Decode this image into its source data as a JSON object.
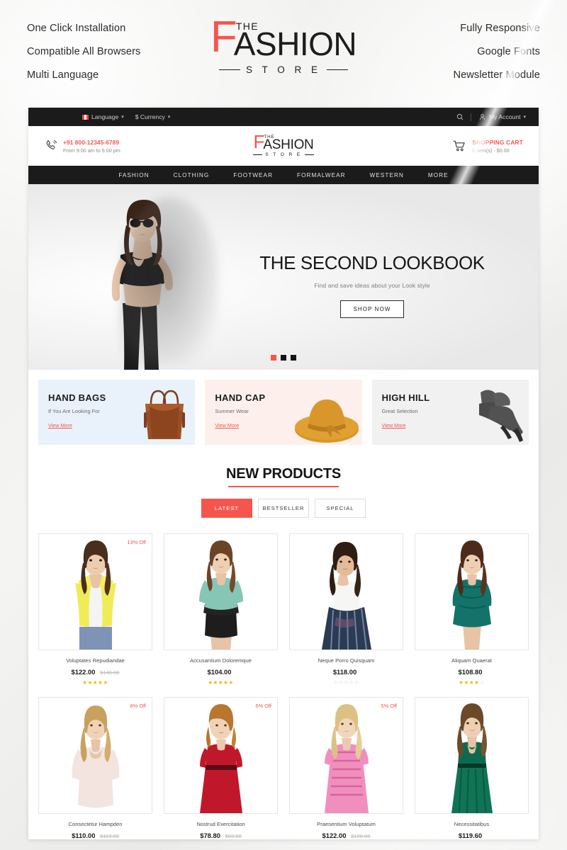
{
  "promo": {
    "left": [
      "One Click Installation",
      "Compatible All Browsers",
      "Multi Language"
    ],
    "right": [
      "Fully Responsive",
      "Google Fonts",
      "Newsletter Module"
    ]
  },
  "brand": {
    "f": "F",
    "the": "THE",
    "ashion": "ASHION",
    "store": "S T O R E"
  },
  "topbar": {
    "language": "Language",
    "currency": "$ Currency",
    "account": "My Account",
    "search_icon": "search-icon",
    "caret": "⌄"
  },
  "header": {
    "phone": "+91 800-12345-6789",
    "hours": "From 9:00 am to 5:00 pm",
    "cart_label": "SHOPPING CART",
    "cart_value": "0 item(s) - $0.00"
  },
  "nav": [
    "FASHION",
    "CLOTHING",
    "FOOTWEAR",
    "FORMALWEAR",
    "WESTERN",
    "MORE"
  ],
  "hero": {
    "title": "THE SECOND LOOKBOOK",
    "subtitle": "Find and save ideas about your Look style",
    "button": "SHOP NOW",
    "slides": 3,
    "active_slide": 1,
    "accent": "#f4564d"
  },
  "banners": [
    {
      "title": "HAND BAGS",
      "subtitle": "If You Are Looking For",
      "link": "View More",
      "bg": "#e9f2fa",
      "art": "handbag"
    },
    {
      "title": "HAND CAP",
      "subtitle": "Summer Wear",
      "link": "View More",
      "bg": "#fdf0ec",
      "art": "hat"
    },
    {
      "title": "HIGH HILL",
      "subtitle": "Great Selection",
      "link": "View More",
      "bg": "#f1f1f1",
      "art": "heels"
    }
  ],
  "new_products": {
    "title": "NEW PRODUCTS",
    "tabs": [
      {
        "label": "LATEST",
        "active": true
      },
      {
        "label": "BESTSELLER",
        "active": false
      },
      {
        "label": "SPECIAL",
        "active": false
      }
    ],
    "products": [
      {
        "name": "Voluptates Repudiandae",
        "price": "$122.00",
        "old_price": "$140.00",
        "badge": "13% Off",
        "rating": 5,
        "garment": "cardigan-yellow"
      },
      {
        "name": "Accusantium Doloremque",
        "price": "$104.00",
        "old_price": "",
        "badge": "",
        "rating": 5,
        "garment": "top-teal"
      },
      {
        "name": "Neque Porro Quisquam",
        "price": "$118.00",
        "old_price": "",
        "badge": "",
        "rating": 0,
        "garment": "skirt-floral"
      },
      {
        "name": "Aliquam Quaerat",
        "price": "$108.80",
        "old_price": "",
        "badge": "",
        "rating": 4,
        "garment": "dress-teal"
      },
      {
        "name": "Consectetur Hampden",
        "price": "$110.00",
        "old_price": "$119.60",
        "badge": "8% Off",
        "rating": 0,
        "garment": "sweater-pink"
      },
      {
        "name": "Nostrud Exercitation",
        "price": "$78.80",
        "old_price": "$83.60",
        "badge": "6% Off",
        "rating": 0,
        "garment": "dress-red"
      },
      {
        "name": "Praesentium Voluptatum",
        "price": "$122.00",
        "old_price": "$128.00",
        "badge": "5% Off",
        "rating": 0,
        "garment": "dress-pink"
      },
      {
        "name": "Necessitatibus",
        "price": "$119.60",
        "old_price": "",
        "badge": "",
        "rating": 0,
        "garment": "dress-green"
      }
    ]
  }
}
